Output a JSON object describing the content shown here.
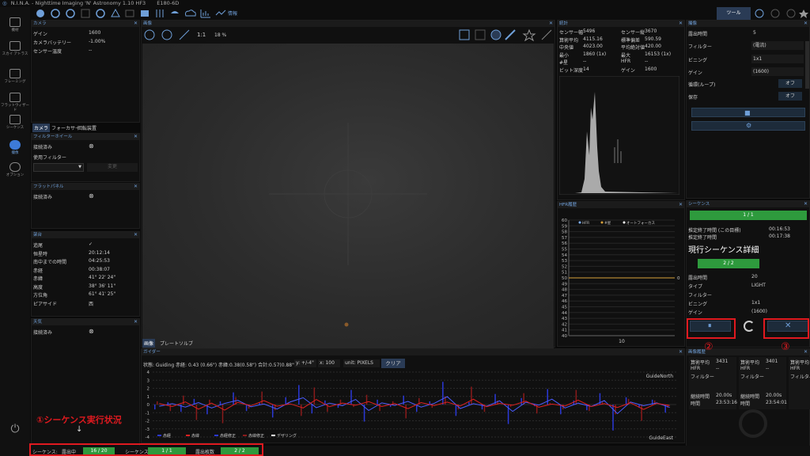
{
  "titlebar": {
    "logo": "◎",
    "app": "N.I.N.A. - Nighttime Imaging 'N' Astronomy 1.10 HF3",
    "camera": "E180-6D"
  },
  "toolbar": {
    "right_tab": "ツール",
    "weather": "情報"
  },
  "nav": [
    {
      "label": "機材"
    },
    {
      "label": "スカイ アトラス"
    },
    {
      "label": "フレーミング"
    },
    {
      "label": "フラットウィザード"
    },
    {
      "label": "シーケンス"
    },
    {
      "label": "撮像"
    },
    {
      "label": "オプション"
    }
  ],
  "camera_panel": {
    "title": "カメラ",
    "rows": [
      {
        "k": "ゲイン",
        "v": "1600"
      },
      {
        "k": "カメラバッテリー",
        "v": "-1.00%"
      },
      {
        "k": "センサー温度",
        "v": "--"
      }
    ]
  },
  "device_tabs": [
    "カメラ",
    "フォーカサー",
    "回転装置"
  ],
  "filter_panel": {
    "title": "フィルターホイール",
    "connected": "接続済み",
    "use_filter": "使用フィルター",
    "change": "変更"
  },
  "flat_panel": {
    "title": "フラットパネル",
    "connected": "接続済み"
  },
  "mount_panel": {
    "title": "架台",
    "rows": [
      {
        "k": "追尾",
        "v": "✓"
      },
      {
        "k": "恒星時",
        "v": "20:12:14"
      },
      {
        "k": "南中までの時間",
        "v": "04:25:53"
      },
      {
        "k": "赤経",
        "v": "00:38:07"
      },
      {
        "k": "赤緯",
        "v": "41° 22' 24\""
      },
      {
        "k": "高度",
        "v": "38° 36' 11\""
      },
      {
        "k": "方位角",
        "v": "61° 41' 25\""
      },
      {
        "k": "ピアサイド",
        "v": "西"
      }
    ]
  },
  "weather_panel": {
    "title": "天気",
    "connected": "接続済み"
  },
  "image_panel": {
    "title": "画像",
    "zoom_fit": "1:1",
    "zoom": "18 %",
    "tabs": [
      "画像",
      "プレートソルブ"
    ]
  },
  "stats_panel": {
    "title": "統計",
    "rows": [
      {
        "k": "センサー幅",
        "v": "5496"
      },
      {
        "k": "センサー縦",
        "v": "3670"
      },
      {
        "k": "算術平均",
        "v": "4115.16"
      },
      {
        "k": "標準偏差",
        "v": "590.59"
      },
      {
        "k": "中央値",
        "v": "4023.00"
      },
      {
        "k": "平均絶対値",
        "v": "420.00"
      },
      {
        "k": "最小",
        "v": "1860 (1x)"
      },
      {
        "k": "最大",
        "v": "16153 (1x)"
      },
      {
        "k": "#星",
        "v": "--"
      },
      {
        "k": "HFR",
        "v": "--"
      },
      {
        "k": "ビット深度",
        "v": "14"
      },
      {
        "k": "ゲイン",
        "v": "1600"
      }
    ]
  },
  "hfr_panel": {
    "title": "HFR履歴",
    "legend": [
      "HFR",
      "#星",
      "オートフォーカス"
    ],
    "yticks": [
      "60",
      "59",
      "58",
      "57",
      "56",
      "55",
      "54",
      "53",
      "52",
      "51",
      "50",
      "49",
      "48",
      "47",
      "46",
      "45",
      "44",
      "43",
      "42",
      "41",
      "40"
    ],
    "xlabel": "10",
    "right_label": "0"
  },
  "imaging_panel": {
    "title": "撮像",
    "rows": [
      {
        "k": "露出時間",
        "v": "5"
      },
      {
        "k": "フィルター",
        "v": "(電流)"
      },
      {
        "k": "ビニング",
        "v": "1x1"
      },
      {
        "k": "ゲイン",
        "v": "(1600)"
      },
      {
        "k": "循環(ループ)",
        "v": "オフ"
      },
      {
        "k": "保存",
        "v": "オフ"
      }
    ]
  },
  "sequence_panel": {
    "title": "シーケンス",
    "progress": "1 / 1",
    "est_end_label": "推定終了時間 (この目標)",
    "est_end": "00:16:53",
    "est_end_all_label": "推定終了時間",
    "est_end_all": "00:17:38",
    "detail_title": "現行シーケンス詳細",
    "detail_progress": "2 / 2",
    "rows": [
      {
        "k": "露出時間",
        "v": "20"
      },
      {
        "k": "タイプ",
        "v": "LIGHT"
      },
      {
        "k": "フィルター",
        "v": ""
      },
      {
        "k": "ビニング",
        "v": "1x1"
      },
      {
        "k": "ゲイン",
        "v": "(1600)"
      }
    ]
  },
  "history_panel": {
    "title": "画像履歴",
    "cards": [
      {
        "mean_label": "算術平均",
        "mean": "3431",
        "hfr_label": "HFR",
        "hfr": "--",
        "filter_label": "フィルター",
        "dur_label": "継続時間",
        "dur": "20.00s",
        "time_label": "時間",
        "time": "23:53:16"
      },
      {
        "mean_label": "算術平均",
        "mean": "3401",
        "hfr_label": "HFR",
        "hfr": "--",
        "filter_label": "フィルター",
        "dur_label": "継続時間",
        "dur": "20.00s",
        "time_label": "時間",
        "time": "23:54:01"
      },
      {
        "mean_label": "算術平均",
        "mean": "",
        "hfr_label": "HFR",
        "hfr": "",
        "filter_label": "フィルタ-",
        "dur_label": "",
        "dur": "",
        "time_label": "",
        "time": ""
      }
    ]
  },
  "guider_panel": {
    "title": "ガイダー",
    "status": "状態: Guiding  赤経: 0.43 (0.66\")  赤緯:0.38(0.58\")  合計:0.57(0.88\")",
    "y_sel": "y: +/-4\"",
    "x_sel": "x: 100",
    "unit_sel": "unit: PIXELS",
    "clear": "クリア",
    "north": "GuideNorth",
    "east": "GuideEast",
    "yticks": [
      "4",
      "3",
      "2",
      "1",
      "0",
      "-1",
      "-2",
      "-3",
      "-4"
    ],
    "legend": [
      "赤経",
      "赤緯",
      "赤経修正",
      "赤緯修正",
      "デザリング"
    ]
  },
  "statusbar": {
    "seq_label": "シーケンス:",
    "exp_label": "露出中",
    "exp_val": "16 / 20",
    "seq2_label": "シーケンス",
    "seq2_val": "1 / 1",
    "count_label": "露出枚数",
    "count_val": "2 / 2"
  },
  "annotations": {
    "a1": "①シーケンス実行状況",
    "arrow": "↓",
    "a2": "②",
    "a3": "③"
  },
  "colors": {
    "accent": "#6f9fd8",
    "green": "#2e9a3d",
    "red_annot": "#e0191f",
    "ra": "#2b39d8",
    "dec": "#e02020"
  },
  "chart_data": [
    {
      "type": "line",
      "title": "HFR履歴",
      "series": [
        {
          "name": "#星",
          "values": [
            50,
            50,
            50,
            50,
            50,
            50,
            50,
            50,
            50,
            50,
            50
          ]
        }
      ],
      "ylim": [
        40,
        60
      ],
      "xlabel": "10"
    },
    {
      "type": "bar",
      "title": "ガイダー",
      "ylim": [
        -4,
        4
      ],
      "series": [
        {
          "name": "赤経",
          "values": [
            -0.6,
            0.3,
            -0.9,
            0.7,
            -1.2,
            0.4,
            1.5,
            -0.8,
            0.2,
            -1.6,
            0.9,
            2.4,
            -1.1,
            0.5,
            -0.4,
            1.8,
            -2.1,
            0.6,
            -0.3,
            1.1,
            -0.9,
            0.4,
            2.8,
            -1.4,
            0.3,
            -0.6,
            1.3,
            -2.4,
            0.8,
            -0.2,
            1.9,
            -1.2,
            0.5,
            -0.7,
            1.4,
            -3.2,
            0.9,
            -0.4,
            0.6,
            -1.0
          ]
        },
        {
          "name": "赤緯",
          "values": [
            0.4,
            -0.8,
            1.1,
            -1.9,
            0.6,
            -2.3,
            0.9,
            -0.5,
            1.6,
            -0.7,
            0.3,
            -1.4,
            2.1,
            -0.9,
            0.6,
            -0.3,
            1.2,
            -0.8,
            0.4,
            -1.7,
            0.8,
            -0.4,
            1.0,
            -0.6,
            2.2,
            -0.9,
            0.5,
            -0.3,
            1.4,
            -1.1,
            0.2,
            -0.6,
            1.8,
            -0.8,
            0.4,
            -1.2,
            0.7,
            -2.0,
            0.5,
            -0.4
          ]
        }
      ]
    }
  ]
}
